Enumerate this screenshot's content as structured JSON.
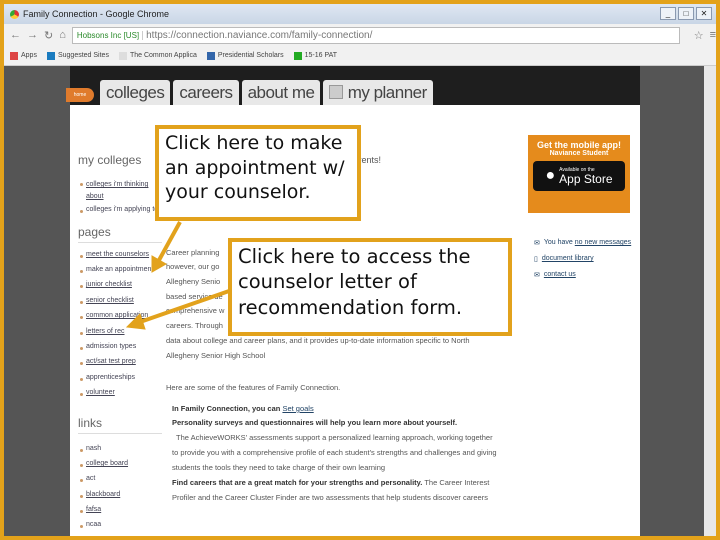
{
  "window": {
    "title": "Family Connection - Google Chrome",
    "controls": [
      "_",
      "□",
      "✕"
    ]
  },
  "toolbar": {
    "ev_cert": "Hobsons Inc [US]",
    "url": "https://connection.naviance.com/family-connection/"
  },
  "bookmarks": [
    "Apps",
    "Suggested Sites",
    "The Common Applica",
    "Presidential Scholars",
    "15-16 PAT"
  ],
  "nav": {
    "home": "home",
    "tabs": [
      "colleges",
      "careers",
      "about me",
      "my planner"
    ]
  },
  "sidebar": {
    "my_colleges": {
      "heading": "my colleges",
      "items": [
        "colleges i'm thinking about",
        "colleges i'm applying to"
      ]
    },
    "pages": {
      "heading": "pages",
      "items": [
        "meet the counselors",
        "make an appointment",
        "junior checklist",
        "senior checklist",
        "common application",
        "letters of rec",
        "admission types",
        "act/sat test prep",
        "apprenticeships",
        "volunteer"
      ]
    },
    "links": {
      "heading": "links",
      "items": [
        "nash",
        "college board",
        "act",
        "blackboard",
        "fafsa",
        "ncaa"
      ]
    }
  },
  "main": {
    "welcome_fragment": "d Parents!",
    "intro_lines": [
      "Career planning",
      "however, our go",
      "Allegheny Senio",
      "based service de",
      "comprehensive w",
      "careers. Through",
      "data about college and career plans, and it provides up-to-date information specific to North",
      "Allegheny Senior High School"
    ],
    "features_intro": "Here are some of the features of Family Connection.",
    "features": [
      {
        "bold": "In Family Connection, you can ",
        "link": "Set goals"
      },
      {
        "bold": "Personality surveys and questionnaires will help you learn more about yourself.",
        "text": [
          "The AchieveWORKS' assessments support a personalized learning approach, working together",
          "to provide you with a comprehensive profile of each student's strengths and challenges and giving",
          "students the tools they need to take charge of their own learning"
        ]
      },
      {
        "bold": "Find careers that are a great match for your strengths and personality.",
        "text": [
          "The Career Interest",
          "Profiler and the Career Cluster Finder are two assessments that help students discover careers"
        ]
      }
    ]
  },
  "right": {
    "app_promo": {
      "title": "Get the mobile app!",
      "subtitle": "Naviance Student",
      "badge_small": "Available on the",
      "badge_big": "App Store"
    },
    "messages_prefix": "You have ",
    "messages_link": "no new messages",
    "document_library": "document library",
    "contact_us": "contact us"
  },
  "annotations": {
    "appointment": "Click here to make an appointment w/ your counselor.",
    "letter": "Click here to access the counselor letter of recommendation form."
  },
  "colors": {
    "annotation_border": "#e2a21c",
    "home_tab": "#e07b2c"
  }
}
